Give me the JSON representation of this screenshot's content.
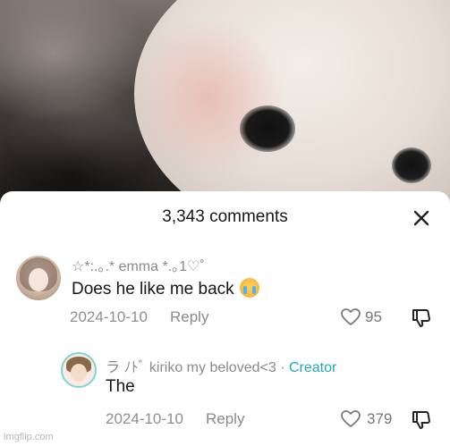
{
  "header": {
    "comment_count_label": "3,343 comments"
  },
  "comments": [
    {
      "author": "☆*:.｡.* emma *.｡1♡˚",
      "text": "Does he like me back",
      "emoji": "loudly-crying-face",
      "date": "2024-10-10",
      "reply_label": "Reply",
      "likes": "95"
    }
  ],
  "replies": [
    {
      "author": "ラ ﾉﾄﾞ kiriko my beloved<3",
      "separator": " · ",
      "creator_badge": "Creator",
      "text": "The",
      "date": "2024-10-10",
      "reply_label": "Reply",
      "likes": "379"
    }
  ],
  "watermark": "imgflip.com",
  "colors": {
    "creator_accent": "#20a8b8",
    "meta_gray": "#8f8f8f"
  },
  "icons": [
    "close-icon",
    "heart-icon",
    "dislike-icon"
  ]
}
